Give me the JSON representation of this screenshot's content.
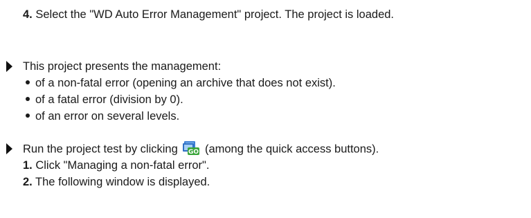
{
  "step4": {
    "number": "4.",
    "text": " Select the \"WD Auto Error Management\" project. The project is loaded."
  },
  "intro": {
    "text": "This project presents the management:",
    "bullets": [
      "of a non-fatal error (opening an archive that does not exist).",
      "of a fatal error (division by 0).",
      "of an error on several levels."
    ]
  },
  "run": {
    "text_before": "Run the project test by clicking ",
    "icon": "go-test-icon",
    "icon_label": "GO",
    "text_after": " (among the quick access buttons).",
    "steps": [
      {
        "number": "1.",
        "text": " Click \"Managing a non-fatal error\"."
      },
      {
        "number": "2.",
        "text": " The following window is displayed."
      }
    ]
  },
  "colors": {
    "icon_blue": "#3d7fd6",
    "icon_green": "#3aa53a"
  }
}
